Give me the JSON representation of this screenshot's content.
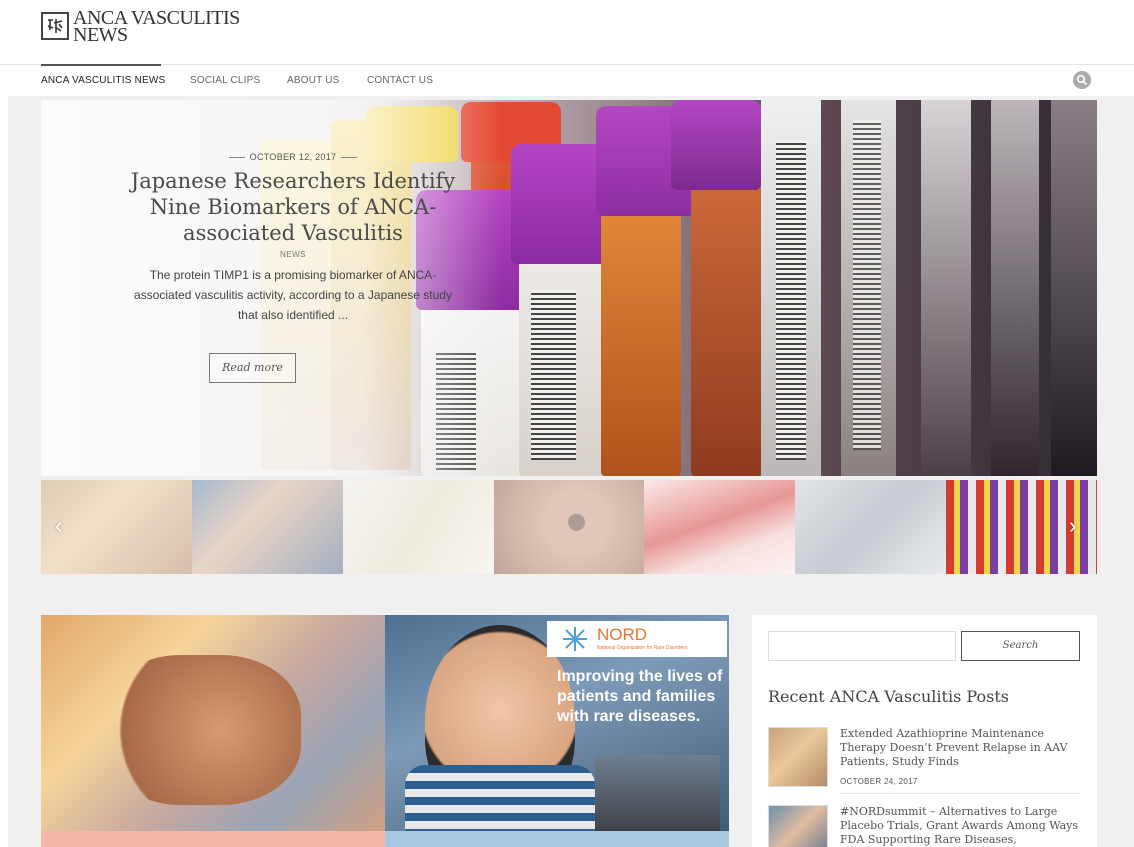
{
  "site": {
    "logo_line1": "ANCA VASCULITIS",
    "logo_line2": "NEWS"
  },
  "nav": {
    "items": [
      {
        "label": "ANCA VASCULITIS NEWS",
        "active": true
      },
      {
        "label": "SOCIAL CLIPS",
        "active": false
      },
      {
        "label": "ABOUT US",
        "active": false
      },
      {
        "label": "CONTACT US",
        "active": false
      }
    ],
    "search_icon": "search-icon"
  },
  "hero": {
    "date": "OCTOBER 12, 2017",
    "title": "Japanese Researchers Identify Nine Biomarkers of ANCA-associated Vasculitis",
    "category": "NEWS",
    "excerpt": "The protein TIMP1 is a promising biomarker of ANCA-associated vasculitis activity, according to a Japanese study that also identified ...",
    "read_more": "Read more"
  },
  "thumbnails": {
    "prev_arrow": "‹",
    "next_arrow": "›",
    "items": [
      "iv-drip-hand",
      "nord-child",
      "documents",
      "eye-closeup",
      "blood-cells",
      "network-icons",
      "blood-tubes"
    ]
  },
  "cards": [
    {
      "image": "iv-drip-hand",
      "strip_color": "#f3b8a8"
    },
    {
      "image": "nord-child",
      "nord_logo": "NORD",
      "nord_sub": "National Organization for Rare Disorders",
      "nord_banner": "Improving the lives of patients and families with rare diseases.",
      "strip_color": "#a8c8e0"
    }
  ],
  "sidebar": {
    "search_placeholder": "",
    "search_button": "Search",
    "recent_title": "Recent ANCA Vasculitis Posts",
    "posts": [
      {
        "title": "Extended Azathioprine Maintenance Therapy Doesn’t Prevent Relapse in AAV Patients, Study Finds",
        "date": "OCTOBER 24, 2017"
      },
      {
        "title": "#NORDsummit – Alternatives to Large Placebo Trials, Grant Awards Among Ways FDA Supporting Rare Diseases,",
        "date": ""
      }
    ]
  }
}
